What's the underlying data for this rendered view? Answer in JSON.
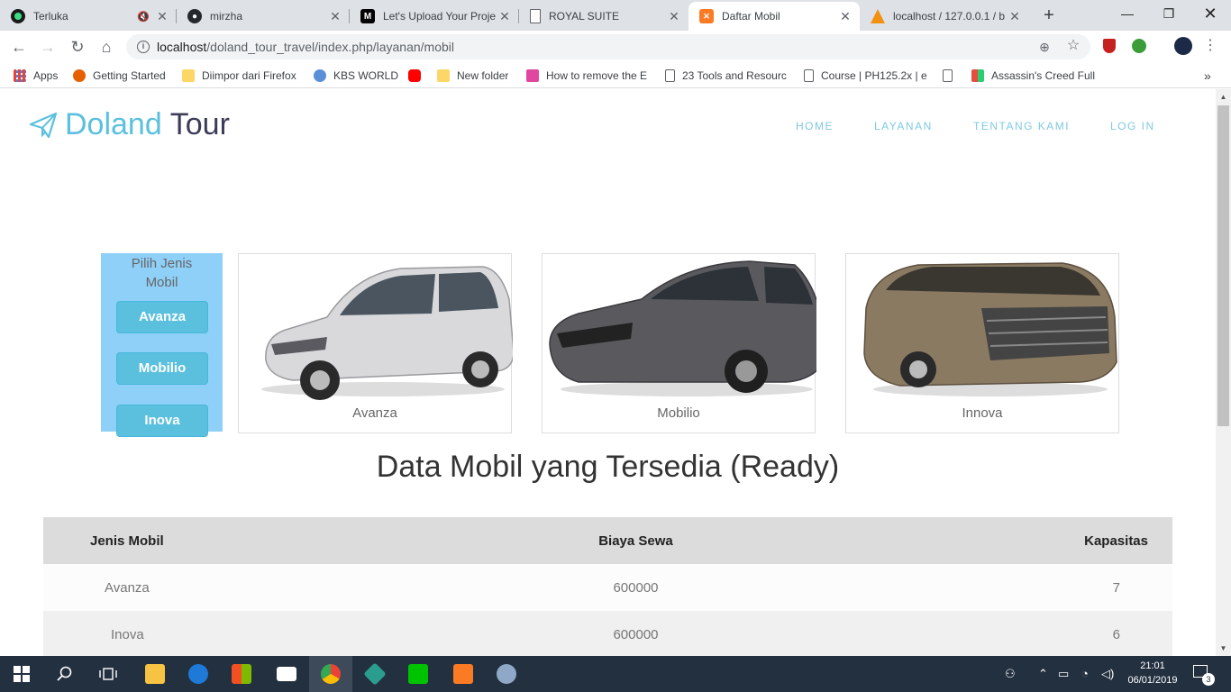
{
  "browser": {
    "tabs": [
      {
        "title": "Terluka",
        "muted": true,
        "icon": "music-app-icon",
        "active": false
      },
      {
        "title": "mirzha",
        "icon": "github-icon",
        "active": false
      },
      {
        "title": "Let's Upload Your Proje",
        "icon": "medium-icon",
        "active": false
      },
      {
        "title": "ROYAL SUITE",
        "icon": "document-icon",
        "active": false
      },
      {
        "title": "Daftar Mobil",
        "icon": "xampp-icon",
        "active": true
      },
      {
        "title": "localhost / 127.0.0.1 / b",
        "icon": "phpmyadmin-icon",
        "active": false
      }
    ],
    "url_host": "localhost",
    "url_path": "/doland_tour_travel/index.php/layanan/mobil",
    "bookmarks": [
      {
        "label": "Apps"
      },
      {
        "label": "Getting Started"
      },
      {
        "label": "Diimpor dari Firefox"
      },
      {
        "label": "KBS WORLD"
      },
      {
        "label": ""
      },
      {
        "label": "New folder"
      },
      {
        "label": "How to remove the E"
      },
      {
        "label": "23 Tools and Resourc"
      },
      {
        "label": "Course | PH125.2x | e"
      },
      {
        "label": ""
      },
      {
        "label": "Assassin's Creed Full"
      }
    ],
    "overflow": "»"
  },
  "site": {
    "brand_part1": "Doland",
    "brand_part2": "Tour",
    "nav": [
      "HOME",
      "LAYANAN",
      "TENTANG KAMI",
      "LOG IN"
    ],
    "sidebar_title": "Pilih Jenis Mobil",
    "car_buttons": [
      "Avanza",
      "Mobilio",
      "Inova"
    ],
    "cars": [
      {
        "caption": "Avanza",
        "color": "#d9d9dc"
      },
      {
        "caption": "Mobilio",
        "color": "#5a5a5e"
      },
      {
        "caption": "Innova",
        "color": "#8a7a62"
      }
    ],
    "heading": "Data Mobil yang Tersedia (Ready)",
    "table": {
      "headers": [
        "Jenis Mobil",
        "Biaya Sewa",
        "Kapasitas"
      ],
      "rows": [
        [
          "Avanza",
          "600000",
          "7"
        ],
        [
          "Inova",
          "600000",
          "6"
        ]
      ]
    }
  },
  "taskbar": {
    "time": "21:01",
    "date": "06/01/2019",
    "notifications": "3"
  }
}
